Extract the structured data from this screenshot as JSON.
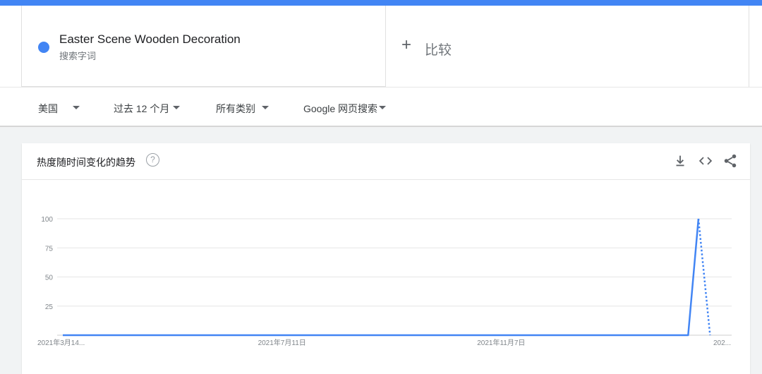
{
  "search_term": {
    "name": "Easter Scene Wooden Decoration",
    "type_label": "搜索字词",
    "color": "#4285f4"
  },
  "compare": {
    "label": "比较"
  },
  "filters": {
    "region": "美国",
    "time_range": "过去 12 个月",
    "category": "所有类别",
    "search_type": "Google 网页搜索"
  },
  "chart_panel": {
    "title": "热度随时间变化的趋势",
    "help_glyph": "?",
    "icons": [
      "download-icon",
      "embed-icon",
      "share-icon"
    ]
  },
  "chart_data": {
    "type": "line",
    "title": "",
    "ylim": [
      0,
      100
    ],
    "yticks": [
      "100",
      "75",
      "50",
      "25"
    ],
    "xticks": [
      {
        "label": "2021年3月14...",
        "week": 0
      },
      {
        "label": "2021年7月11日",
        "week": 17
      },
      {
        "label": "2021年11月7日",
        "week": 34
      },
      {
        "label": "202...",
        "week": 51
      }
    ],
    "grid": true,
    "series": [
      {
        "color": "#4285f4",
        "solid_points": [
          [
            0,
            0
          ],
          [
            48.5,
            0
          ],
          [
            49.3,
            100
          ]
        ],
        "partial_points": [
          [
            49.3,
            100
          ],
          [
            50.2,
            0
          ]
        ]
      }
    ]
  }
}
